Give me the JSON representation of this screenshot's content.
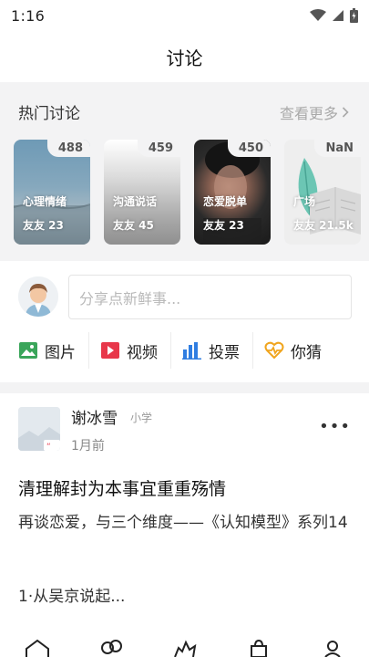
{
  "status": {
    "time": "1:16"
  },
  "header": {
    "title": "讨论"
  },
  "hot": {
    "title": "热门讨论",
    "more_label": "查看更多",
    "cards": [
      {
        "count": "488",
        "name": "心理情绪",
        "friends": "友友 23"
      },
      {
        "count": "459",
        "name": "沟通说话",
        "friends": "友友 45"
      },
      {
        "count": "450",
        "name": "恋爱脱单",
        "friends": "友友 23"
      },
      {
        "count": "NaN",
        "name": "广场",
        "friends": "友友 21.5k"
      }
    ]
  },
  "composer": {
    "placeholder": "分享点新鲜事...",
    "actions": [
      {
        "label": "图片",
        "icon": "image-icon"
      },
      {
        "label": "视频",
        "icon": "video-icon"
      },
      {
        "label": "投票",
        "icon": "poll-icon"
      },
      {
        "label": "你猜",
        "icon": "heartbeat-icon"
      }
    ]
  },
  "post": {
    "author": "谢冰雪",
    "grade": "小学",
    "time": "1月前",
    "title": "清理解封为本事宜重重殇情",
    "body": "再谈恋爱，与三个维度——《认知模型》系列14",
    "excerpt": "1·从吴京说起..."
  },
  "colors": {
    "accent_orange": "#f0a51e",
    "image_green": "#3aa55a",
    "video_red": "#e8374a",
    "poll_blue": "#2f7de1"
  }
}
